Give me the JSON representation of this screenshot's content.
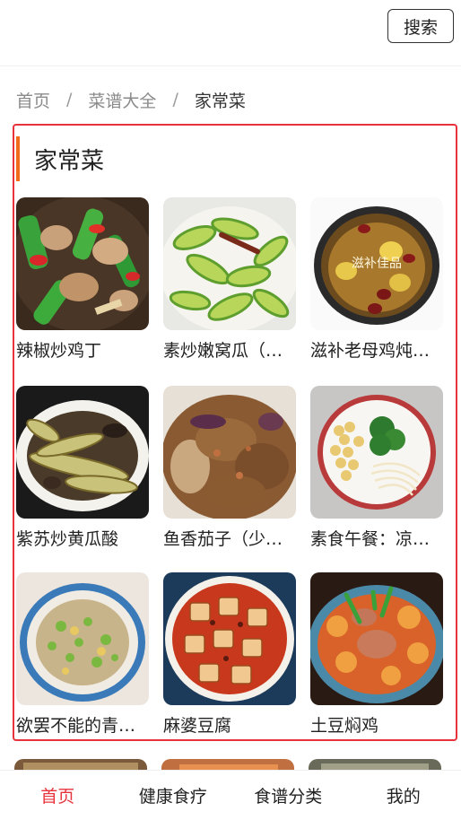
{
  "header": {
    "search_label": "搜索"
  },
  "breadcrumb": {
    "home": "首页",
    "recipes": "菜谱大全",
    "current": "家常菜",
    "sep": "/"
  },
  "section": {
    "title": "家常菜"
  },
  "recipes": [
    {
      "name": "辣椒炒鸡丁",
      "icon": "spicy-chicken-dish"
    },
    {
      "name": "素炒嫩窝瓜（…",
      "icon": "zucchini-stirfry-dish"
    },
    {
      "name": "滋补老母鸡炖…",
      "icon": "chicken-soup-pot"
    },
    {
      "name": "紫苏炒黄瓜酸",
      "icon": "perilla-cucumber-dish"
    },
    {
      "name": "鱼香茄子（少…",
      "icon": "eggplant-dish"
    },
    {
      "name": "素食午餐：凉…",
      "icon": "vegetarian-lunch-bowl"
    },
    {
      "name": "欲罢不能的青…",
      "icon": "green-pepper-egg-dish"
    },
    {
      "name": "麻婆豆腐",
      "icon": "mapo-tofu-dish"
    },
    {
      "name": "土豆焖鸡",
      "icon": "potato-chicken-dish"
    }
  ],
  "watermark": "滋补佳品",
  "bottom_nav": [
    {
      "label": "首页",
      "active": true
    },
    {
      "label": "健康食疗",
      "active": false
    },
    {
      "label": "食谱分类",
      "active": false
    },
    {
      "label": "我的",
      "active": false
    }
  ],
  "colors": {
    "accent": "#e8323c",
    "title_bar": "#f26a1b"
  }
}
